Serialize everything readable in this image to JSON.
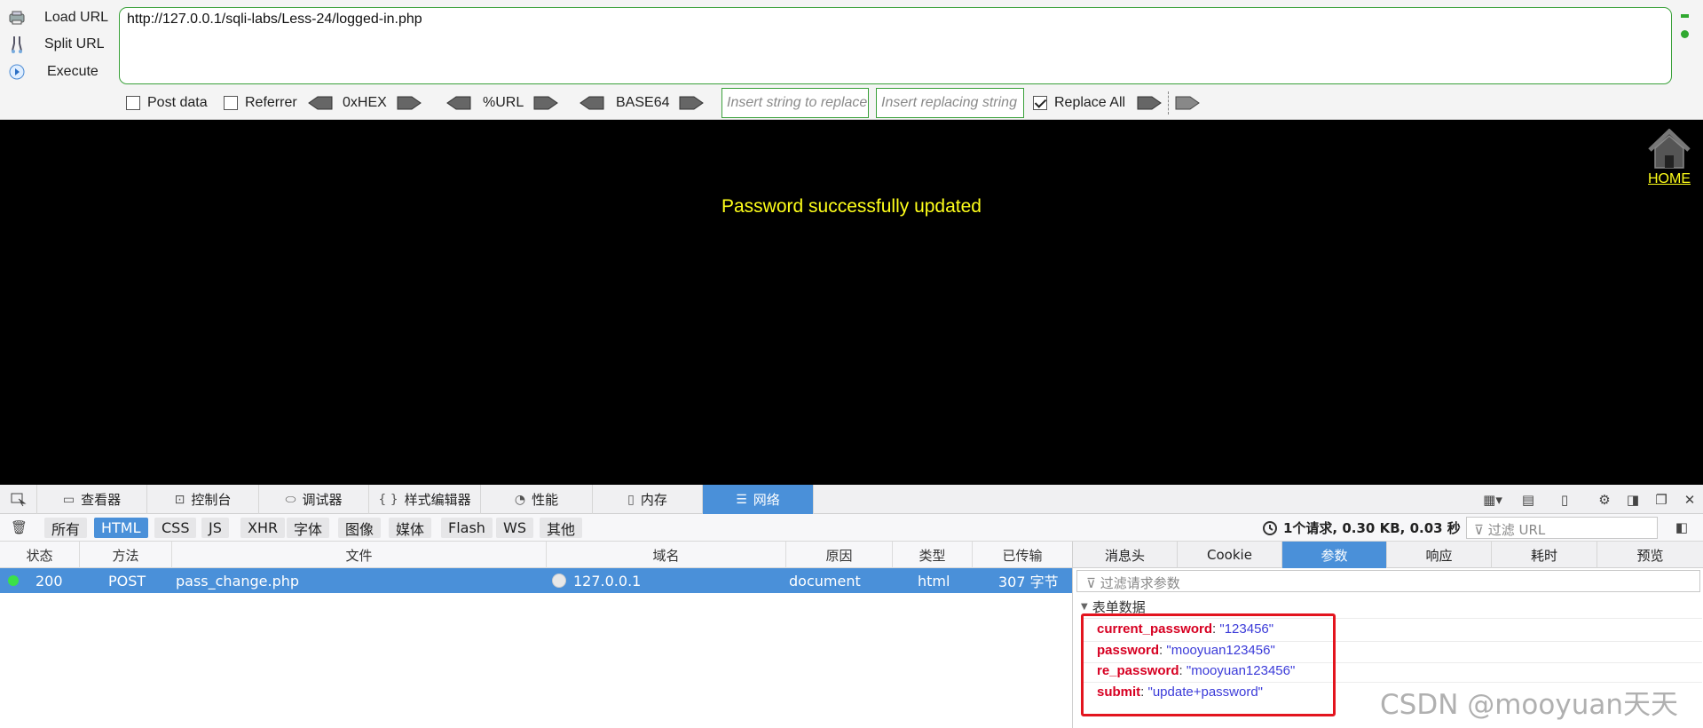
{
  "hackbar": {
    "load_url": "Load URL",
    "split_url": "Split URL",
    "execute": "Execute",
    "url_value": "http://127.0.0.1/sqli-labs/Less-24/logged-in.php",
    "post_data_label": "Post data",
    "post_data_checked": false,
    "referrer_label": "Referrer",
    "referrer_checked": false,
    "hex_label": "0xHEX",
    "urlenc_label": "%URL",
    "base64_label": "BASE64",
    "replace_placeholder": "Insert string to replace",
    "replacing_placeholder": "Insert replacing string",
    "replace_all_label": "Replace All",
    "replace_all_checked": true,
    "accent_color": "#3aa13a"
  },
  "page": {
    "message": "Password successfully updated",
    "home_label": "HOME",
    "background": "#000000",
    "text_color": "#ffff1a"
  },
  "devtools": {
    "tabs": [
      {
        "label": "查看器",
        "icon": "inspector-icon"
      },
      {
        "label": "控制台",
        "icon": "console-icon"
      },
      {
        "label": "调试器",
        "icon": "debugger-icon"
      },
      {
        "label": "样式编辑器",
        "icon": "style-editor-icon"
      },
      {
        "label": "性能",
        "icon": "performance-icon"
      },
      {
        "label": "内存",
        "icon": "memory-icon"
      },
      {
        "label": "网络",
        "icon": "network-icon"
      }
    ],
    "active_tab": "网络",
    "filters": [
      "所有",
      "HTML",
      "CSS",
      "JS",
      "XHR",
      "字体",
      "图像",
      "媒体",
      "Flash",
      "WS",
      "其他"
    ],
    "active_filter": "HTML",
    "summary": "1个请求, 0.30 KB, 0.03 秒",
    "url_filter_placeholder": "过滤 URL",
    "columns": [
      "状态",
      "方法",
      "文件",
      "域名",
      "原因",
      "类型",
      "已传输"
    ],
    "request": {
      "status": "200",
      "method": "POST",
      "file": "pass_change.php",
      "domain": "127.0.0.1",
      "cause": "document",
      "type": "html",
      "transferred": "307 字节"
    },
    "side_tabs": [
      "消息头",
      "Cookie",
      "参数",
      "响应",
      "耗时",
      "预览"
    ],
    "active_side_tab": "参数",
    "param_filter_placeholder": "过滤请求参数",
    "form_section": "表单数据",
    "params": [
      {
        "key": "current_password",
        "value": "\"123456\""
      },
      {
        "key": "password",
        "value": "\"mooyuan123456\""
      },
      {
        "key": "re_password",
        "value": "\"mooyuan123456\""
      },
      {
        "key": "submit",
        "value": "\"update+password\""
      }
    ],
    "highlight_color": "#e3141e",
    "active_color": "#4a90d9"
  },
  "watermark": "CSDN @mooyuan天天"
}
